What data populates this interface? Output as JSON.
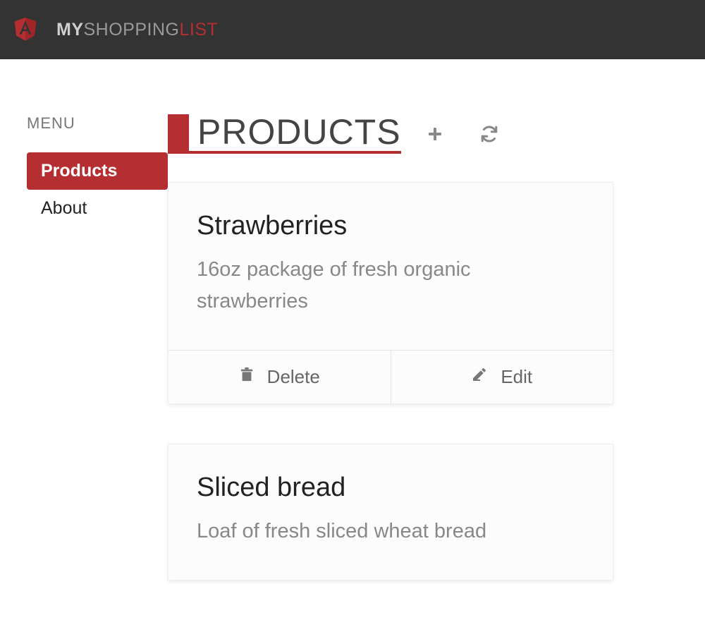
{
  "header": {
    "brand_1": "MY",
    "brand_2": "SHOPPING",
    "brand_3": "LIST"
  },
  "sidebar": {
    "label": "MENU",
    "items": [
      {
        "label": "Products",
        "active": true
      },
      {
        "label": "About",
        "active": false
      }
    ]
  },
  "page": {
    "title": "PRODUCTS"
  },
  "actions": {
    "delete": "Delete",
    "edit": "Edit"
  },
  "products": [
    {
      "name": "Strawberries",
      "description": "16oz package of fresh organic strawberries"
    },
    {
      "name": "Sliced bread",
      "description": "Loaf of fresh sliced wheat bread"
    }
  ]
}
